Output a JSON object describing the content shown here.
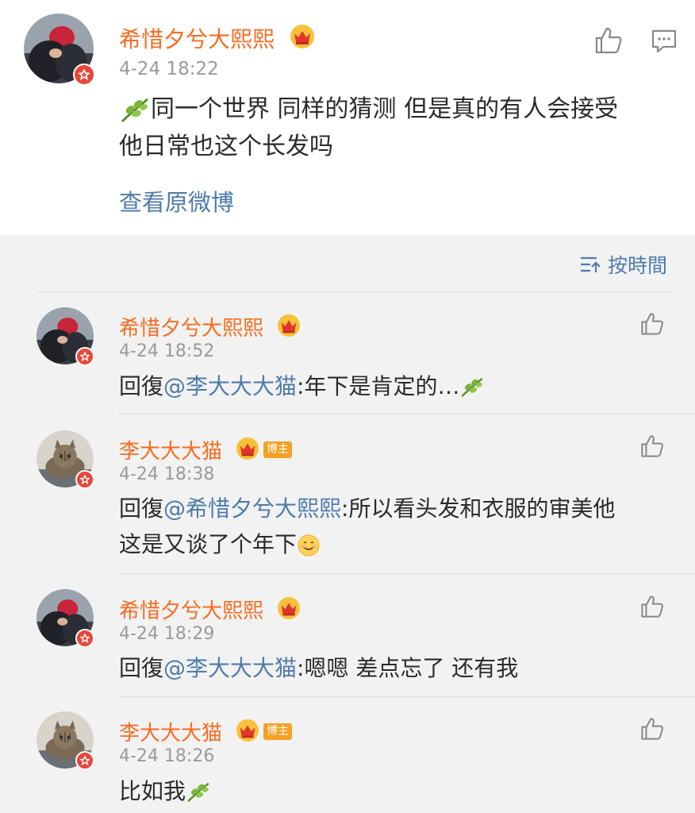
{
  "post": {
    "username": "希惜夕兮大熙熙",
    "timestamp": "4-24 18:22",
    "text_line1": "同一个世界 同样的猜测 但是真的有人会接受",
    "text_line2": "他日常也这个长发吗",
    "view_original": "查看原微博"
  },
  "sort": {
    "label": "按時間"
  },
  "comments": [
    {
      "username": "希惜夕兮大熙熙",
      "owner_tag": "",
      "timestamp": "4-24 18:52",
      "reply_prefix": "回復",
      "mention": "@李大大大猫",
      "text_after": ":年下是肯定的…",
      "text_line2": ""
    },
    {
      "username": "李大大大猫",
      "owner_tag": "博主",
      "timestamp": "4-24 18:38",
      "reply_prefix": "回復",
      "mention": "@希惜夕兮大熙熙",
      "text_after": ":所以看头发和衣服的审美他",
      "text_line2": "这是又谈了个年下"
    },
    {
      "username": "希惜夕兮大熙熙",
      "owner_tag": "",
      "timestamp": "4-24 18:29",
      "reply_prefix": "回復",
      "mention": "@李大大大猫",
      "text_after": ":嗯嗯 差点忘了 还有我",
      "text_line2": ""
    },
    {
      "username": "李大大大猫",
      "owner_tag": "博主",
      "timestamp": "4-24 18:26",
      "reply_prefix": "",
      "mention": "",
      "text_after": "比如我",
      "text_line2": ""
    }
  ],
  "colors": {
    "username": "#f86b1e",
    "link": "#4e7bad",
    "timestamp": "#9a9a9a",
    "owner_tag": "#f6a025",
    "badge": "#e8473a"
  },
  "icons": [
    "crown-icon",
    "verified-badge-icon",
    "thumbs-up-icon",
    "comment-icon",
    "sort-icon",
    "leaf-emoji-icon",
    "smile-emoji-icon"
  ]
}
